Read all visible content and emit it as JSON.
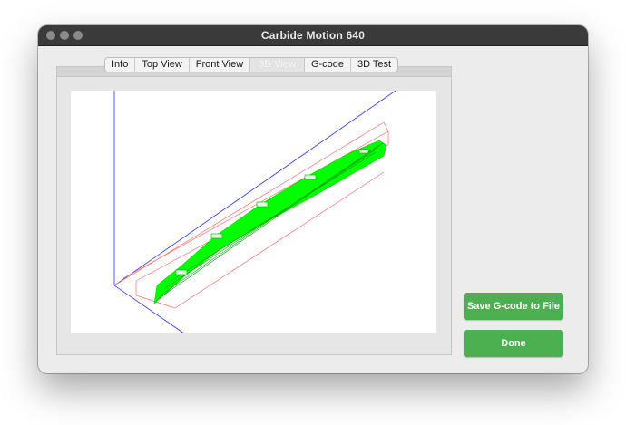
{
  "window": {
    "title": "Carbide Motion 640"
  },
  "tabs": [
    {
      "label": "Info",
      "active": false
    },
    {
      "label": "Top View",
      "active": false
    },
    {
      "label": "Front View",
      "active": false
    },
    {
      "label": "3D View",
      "active": true
    },
    {
      "label": "G-code",
      "active": false
    },
    {
      "label": "3D Test",
      "active": false
    }
  ],
  "buttons": {
    "save_label": "Save G-code to File",
    "done_label": "Done"
  },
  "colors": {
    "toolpath": "#00ff00",
    "x_axis": "#ff0000",
    "y_axis": "#0000ff",
    "button": "#4caf50"
  }
}
